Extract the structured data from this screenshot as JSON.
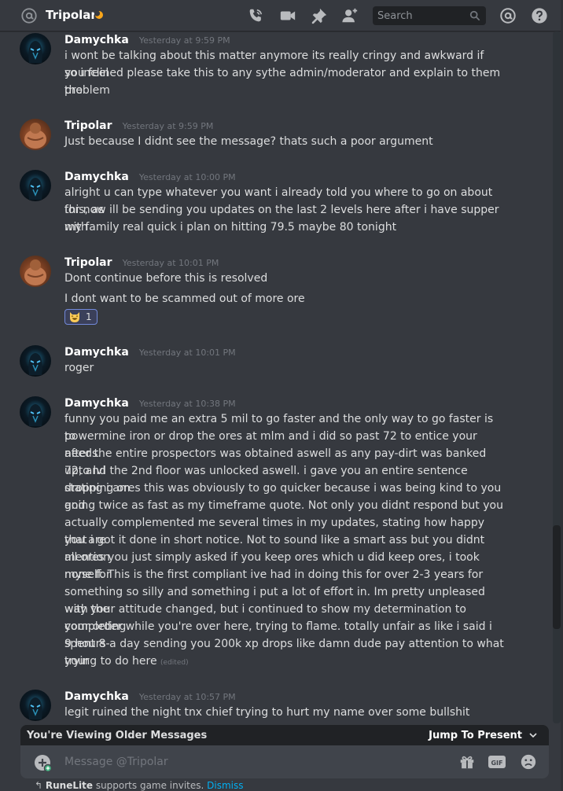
{
  "header": {
    "channel_name": "Tripolar",
    "search_placeholder": "Search",
    "icons": [
      "at-sign-icon",
      "moon-status-icon",
      "phone-call-icon",
      "video-call-icon",
      "pin-icon",
      "add-friend-icon",
      "search-icon",
      "mention-icon",
      "help-icon"
    ]
  },
  "messages": [
    {
      "author": "Damychka",
      "timestamp": "Yesterday at 9:59 PM",
      "avatar": "damychka",
      "lines": [
        "i wont be talking about this matter anymore its really cringy and awkward if you feel",
        "so inclined please take this to any sythe admin/moderator and explain to them the",
        "problem"
      ]
    },
    {
      "author": "Tripolar",
      "timestamp": "Yesterday at 9:59 PM",
      "avatar": "tripolar",
      "lines": [
        "Just because I didnt see the message? thats such a poor argument"
      ]
    },
    {
      "author": "Damychka",
      "timestamp": "Yesterday at 10:00 PM",
      "avatar": "damychka",
      "lines": [
        "alright u can type whatever you want i already told you where to go on about this, as",
        "for now ill be sending you updates on the last 2 levels here after i have supper with",
        "my family real quick i plan on hitting 79.5 maybe 80 tonight"
      ]
    },
    {
      "author": "Tripolar",
      "timestamp": "Yesterday at 10:01 PM",
      "avatar": "tripolar",
      "lines": [
        "Dont continue before this is resolved"
      ],
      "followup": "I dont want to be scammed out of more ore",
      "reaction": {
        "emoji": "laughing-cat-emoji-icon",
        "count": "1"
      }
    },
    {
      "author": "Damychka",
      "timestamp": "Yesterday at 10:01 PM",
      "avatar": "damychka",
      "lines": [
        "roger"
      ]
    },
    {
      "author": "Damychka",
      "timestamp": "Yesterday at 10:38 PM",
      "avatar": "damychka",
      "lines": [
        "funny you paid me an extra 5 mil to go faster and the only way to go faster is to",
        "powermine iron or drop the ores at mlm and i did so past 72 to entice your needs.",
        "after the entire prospectors was obtained aswell as any pay-dirt was banked upto lvl",
        "72, and the 2nd floor was unlocked aswell. i gave you an entire sentence stating i am",
        "dropping ores this was obviously to go quicker because i was being kind to you and",
        "going twice as fast as my timeframe quote. Not only you didnt respond but you",
        "actually complemented me several times in my updates, stating how happy you are",
        "that i got it done in short notice. Not to sound like a smart ass but you didnt mention",
        "all ores you just simply asked if you keep ores which u did keep ores, i took none for",
        "myself. This is the first compliant ive had in doing this for over 2-3 years for",
        "something so silly and something i put a lot of effort in. Im pretty unpleased with the",
        "way your attitude changed, but i continued to show my determination to completing",
        "your order while you're over here, trying to flame. totally unfair as like i said i spent 8-",
        "9 hours a day sending you 200k xp drops like damn dude pay attention to what your",
        "trying to do here"
      ],
      "edited": "(edited)"
    },
    {
      "author": "Damychka",
      "timestamp": "Yesterday at 10:57 PM",
      "avatar": "damychka",
      "lines": [
        "legit ruined the night tnx chief trying to hurt my name over some bullshit"
      ]
    }
  ],
  "older_bar": {
    "text": "You're Viewing Older Messages",
    "jump": "Jump To Present"
  },
  "composer": {
    "placeholder": "Message @Tripolar",
    "icons": [
      "upload-plus-icon",
      "gift-icon",
      "gif-icon",
      "emoji-icon"
    ]
  },
  "footer": {
    "app": "RuneLite",
    "text": " supports game invites. ",
    "dismiss": "Dismiss"
  },
  "colors": {
    "background": "#36393f",
    "author": "#ffffff",
    "text": "#dcddde",
    "timestamp": "#72767d",
    "link": "#00b0f4",
    "reaction_bg": "#3b405a",
    "reaction_border": "#7289da"
  }
}
